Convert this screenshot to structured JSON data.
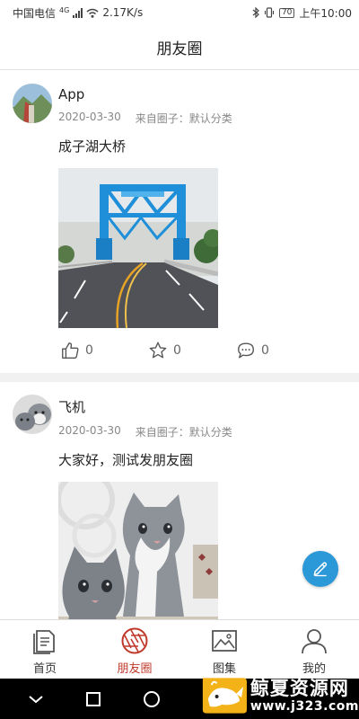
{
  "status_bar": {
    "carrier": "中国电信",
    "network": "4G",
    "speed": "2.17K/s",
    "battery": "70",
    "time": "上午10:00"
  },
  "header": {
    "title": "朋友圈"
  },
  "posts": [
    {
      "author": "App",
      "date": "2020-03-30",
      "source": "来自圈子：默认分类",
      "text": "成子湖大桥",
      "likes": "0",
      "stars": "0",
      "comments": "0"
    },
    {
      "author": "飞机",
      "date": "2020-03-30",
      "source": "来自圈子：默认分类",
      "text": "大家好，测试发朋友圈"
    }
  ],
  "tabs": [
    {
      "label": "首页",
      "icon": "document-icon"
    },
    {
      "label": "朋友圈",
      "icon": "aperture-icon",
      "active": true
    },
    {
      "label": "图集",
      "icon": "image-icon"
    },
    {
      "label": "我的",
      "icon": "user-icon"
    }
  ],
  "watermark": {
    "title": "鲸夏资源网",
    "url": "www.j323.com"
  },
  "colors": {
    "accent_red": "#c0392b",
    "fab_blue": "#2b98d8",
    "bridge_blue": "#1e8fd8"
  }
}
